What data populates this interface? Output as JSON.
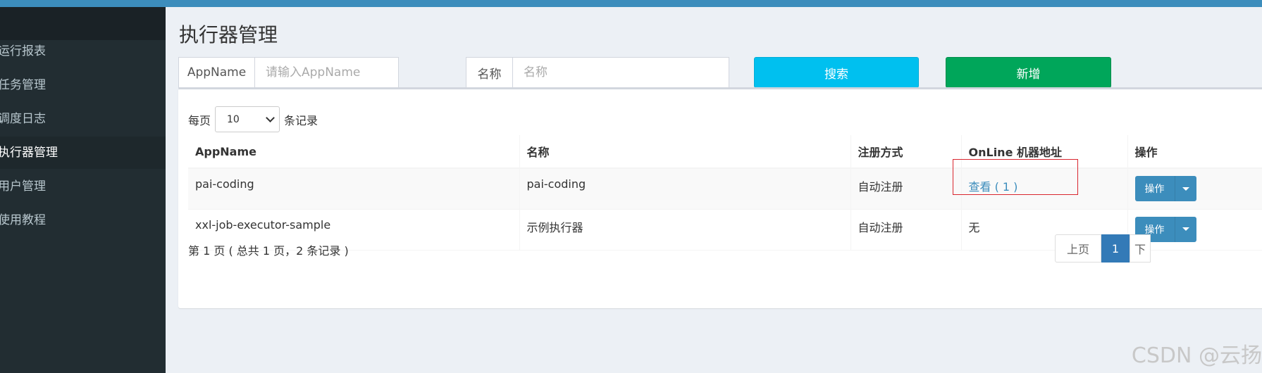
{
  "sidebar": {
    "items": [
      {
        "label": "运行报表"
      },
      {
        "label": "任务管理"
      },
      {
        "label": "调度日志"
      },
      {
        "label": "执行器管理"
      },
      {
        "label": "用户管理"
      },
      {
        "label": "使用教程"
      }
    ]
  },
  "page": {
    "title": "执行器管理"
  },
  "filters": {
    "appname_label": "AppName",
    "appname_placeholder": "请输入AppName",
    "name_label": "名称",
    "name_placeholder": "名称",
    "search_label": "搜索",
    "add_label": "新增"
  },
  "table_controls": {
    "per_page_prefix": "每页",
    "per_page_value": "10",
    "per_page_suffix": "条记录"
  },
  "table": {
    "headers": [
      "AppName",
      "名称",
      "注册方式",
      "OnLine 机器地址",
      "操作"
    ],
    "rows": [
      {
        "appname": "pai-coding",
        "name": "pai-coding",
        "reg": "自动注册",
        "online": "查看 ( 1 )",
        "action": "操作"
      },
      {
        "appname": "xxl-job-executor-sample",
        "name": "示例执行器",
        "reg": "自动注册",
        "online": "无",
        "action": "操作"
      }
    ]
  },
  "pagination": {
    "info": "第 1 页 ( 总共 1 页，2 条记录 )",
    "prev": "上页",
    "current": "1",
    "next": "下"
  },
  "watermark": "CSDN @云扬"
}
